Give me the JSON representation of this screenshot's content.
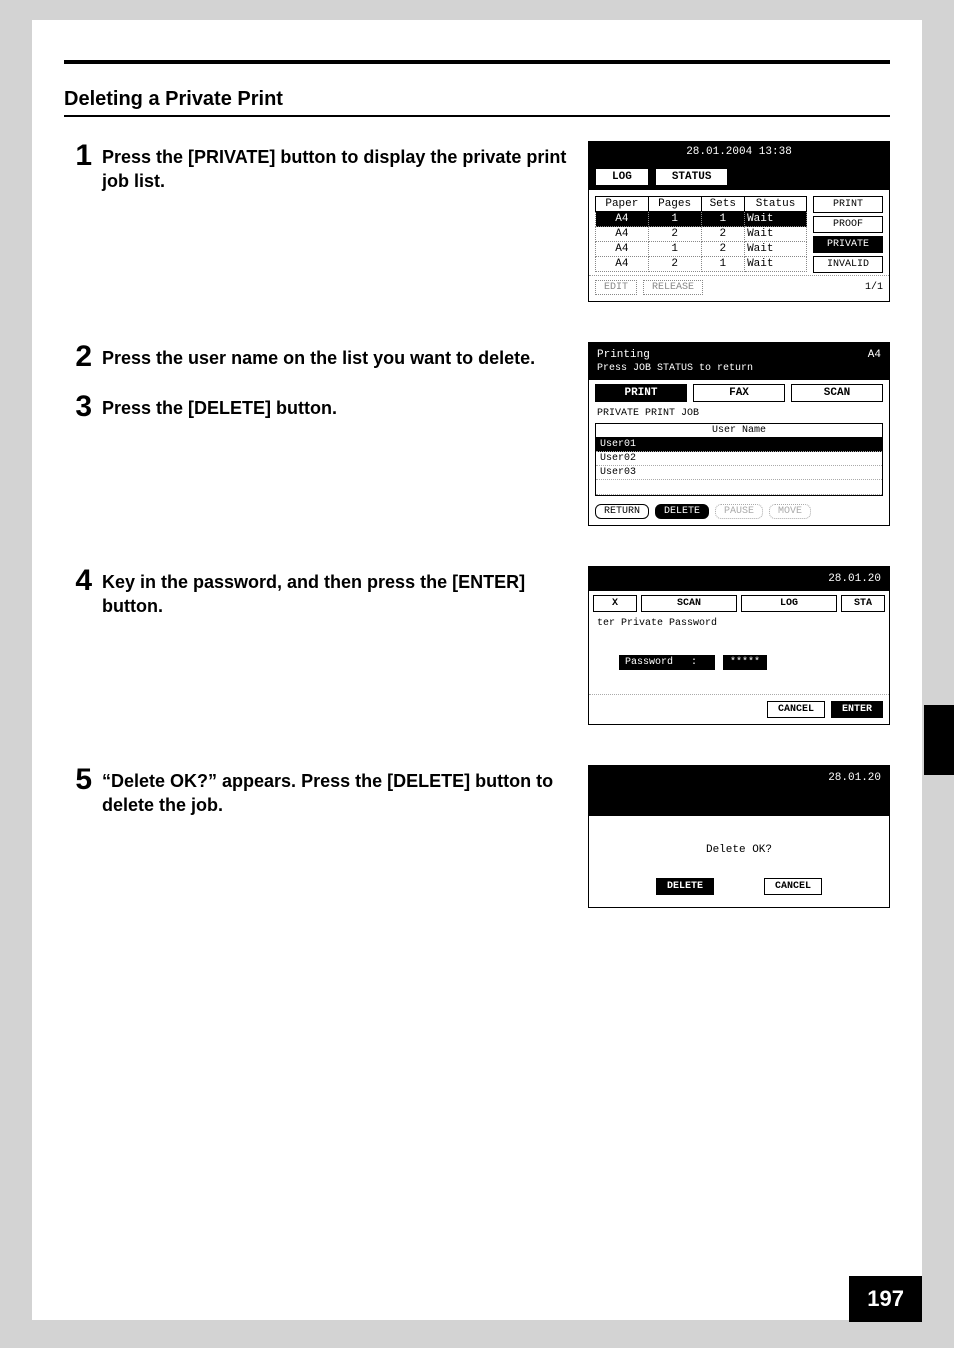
{
  "page_number": "197",
  "section_title": "Deleting a Private Print",
  "steps": {
    "s1": {
      "num": "1",
      "text": "Press the [PRIVATE] button to display the private print job list."
    },
    "s2": {
      "num": "2",
      "text": "Press the user name on the list you want to delete."
    },
    "s3": {
      "num": "3",
      "text": "Press the [DELETE] button."
    },
    "s4": {
      "num": "4",
      "text": "Key in the password, and then press the [ENTER] button."
    },
    "s5": {
      "num": "5",
      "text": "“Delete OK?” appears. Press the [DELETE] button to delete the job."
    }
  },
  "screen1": {
    "datetime": "28.01.2004 13:38",
    "tab_log": "LOG",
    "tab_status": "STATUS",
    "th_paper": "Paper",
    "th_pages": "Pages",
    "th_sets": "Sets",
    "th_status": "Status",
    "rows": [
      {
        "paper": "A4",
        "pages": "1",
        "sets": "1",
        "status": "Wait"
      },
      {
        "paper": "A4",
        "pages": "2",
        "sets": "2",
        "status": "Wait"
      },
      {
        "paper": "A4",
        "pages": "1",
        "sets": "2",
        "status": "Wait"
      },
      {
        "paper": "A4",
        "pages": "2",
        "sets": "1",
        "status": "Wait"
      }
    ],
    "side": {
      "print": "PRINT",
      "proof": "PROOF",
      "private": "PRIVATE",
      "invalid": "INVALID"
    },
    "footer": {
      "edit": "EDIT",
      "release": "RELEASE",
      "pager": "1/1"
    }
  },
  "screen2": {
    "status": "Printing",
    "a4": "A4",
    "hint": "Press JOB STATUS to return",
    "tabs": {
      "print": "PRINT",
      "fax": "FAX",
      "scan": "SCAN"
    },
    "subtitle": "PRIVATE PRINT JOB",
    "list_header": "User Name",
    "users": [
      "User01",
      "User02",
      "User03"
    ],
    "buttons": {
      "return": "RETURN",
      "delete": "DELETE",
      "pause": "PAUSE",
      "move": "MOVE"
    }
  },
  "screen3": {
    "date": "28.01.20",
    "tabs": {
      "x": "X",
      "scan": "SCAN",
      "log": "LOG",
      "sta": "STA"
    },
    "msg": "ter Private Password",
    "pw_label": "Password",
    "pw_value": "*****",
    "buttons": {
      "cancel": "CANCEL",
      "enter": "ENTER"
    }
  },
  "screen4": {
    "date": "28.01.20",
    "question": "Delete OK?",
    "buttons": {
      "delete": "DELETE",
      "cancel": "CANCEL"
    }
  }
}
